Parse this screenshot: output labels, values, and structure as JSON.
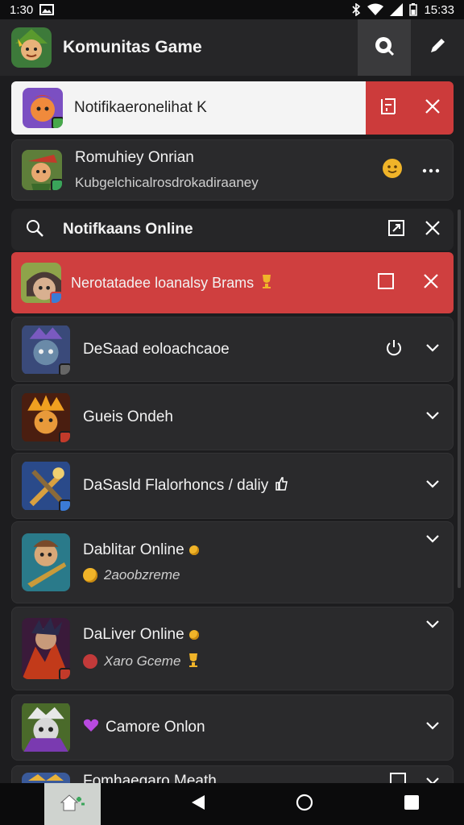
{
  "status_bar": {
    "time": "1:30",
    "clock_right": "15:33"
  },
  "app_bar": {
    "title": "Komunitas Game",
    "icons": [
      "game-avatar-icon",
      "search-chat-icon",
      "edit-pencil-icon"
    ]
  },
  "toast": {
    "text": "Notifikaeronelihat K",
    "actions": [
      "clipboard-icon",
      "close-icon"
    ]
  },
  "featured_card": {
    "title": "Romuhiey Onrian",
    "subtitle": "Kubgelchicalrosdrokadiraaney",
    "icons": [
      "emoji-icon",
      "more-icon"
    ]
  },
  "search": {
    "label": "Notifkaans Online",
    "icons": [
      "search-icon",
      "external-box-icon",
      "close-icon"
    ]
  },
  "highlight": {
    "text": "Nerotatadee loanalsy Brams",
    "icons": [
      "checkbox-icon",
      "close-icon"
    ]
  },
  "list": [
    {
      "title": "DeSaad eoloachcaoe",
      "subtitle": "",
      "icons": [
        "power-icon",
        "chevron-down-icon"
      ]
    },
    {
      "title": "Gueis Ondeh",
      "subtitle": "",
      "icons": [
        "chevron-down-icon"
      ]
    },
    {
      "title": "DaSasld Flalorhoncs / daliy",
      "subtitle": "",
      "icons": [
        "chevron-down-icon"
      ]
    },
    {
      "title": "Dablitar Online",
      "subtitle": "2aoobzreme",
      "icons": [
        "chevron-down-icon"
      ]
    },
    {
      "title": "DaLiver Online",
      "subtitle": "Xaro Gceme",
      "icons": [
        "chevron-down-icon"
      ]
    },
    {
      "title": "Camore Onlon",
      "subtitle": "",
      "icons": [
        "chevron-down-icon"
      ]
    },
    {
      "title": "Fomhaegaro Meath",
      "subtitle": "",
      "icons": [
        "checkbox-icon",
        "chevron-down-icon"
      ]
    }
  ],
  "bottom_nav": {
    "icons": [
      "home-icon",
      "back-icon",
      "circle-home-icon",
      "square-recents-icon"
    ]
  },
  "colors": {
    "accent_red": "#cf3f3f",
    "background": "#1d1d1f",
    "card": "#2a2a2c"
  }
}
